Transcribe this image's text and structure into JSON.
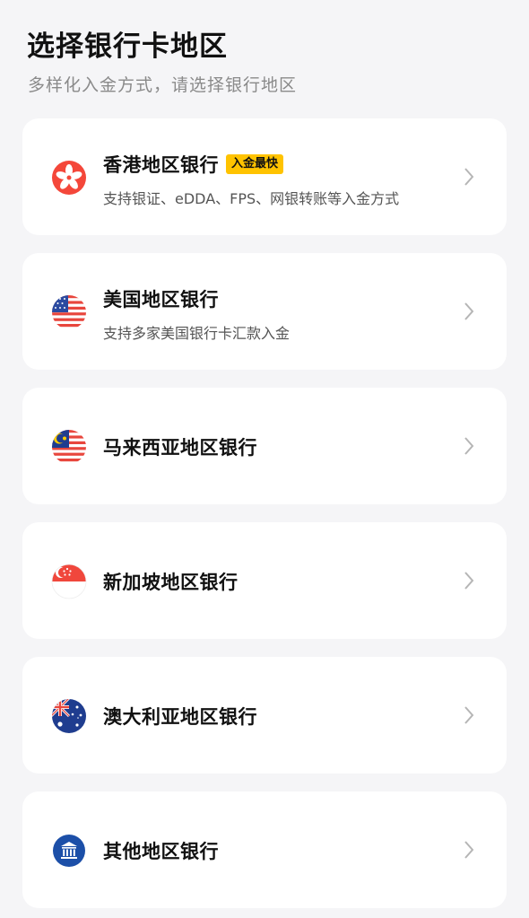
{
  "header": {
    "title": "选择银行卡地区",
    "subtitle": "多样化入金方式，请选择银行地区"
  },
  "regions": [
    {
      "title": "香港地区银行",
      "badge": "入金最快",
      "desc": "支持银证、eDDA、FPS、网银转账等入金方式",
      "icon": "hong-kong-flag-icon"
    },
    {
      "title": "美国地区银行",
      "desc": "支持多家美国银行卡汇款入金",
      "icon": "us-flag-icon"
    },
    {
      "title": "马来西亚地区银行",
      "icon": "malaysia-flag-icon"
    },
    {
      "title": "新加坡地区银行",
      "icon": "singapore-flag-icon"
    },
    {
      "title": "澳大利亚地区银行",
      "icon": "australia-flag-icon"
    },
    {
      "title": "其他地区银行",
      "icon": "bank-building-icon"
    }
  ],
  "colors": {
    "background": "#f5f5f7",
    "badge": "#ffc300",
    "hk_red": "#f4473a",
    "bank_blue": "#1c4fa8"
  }
}
